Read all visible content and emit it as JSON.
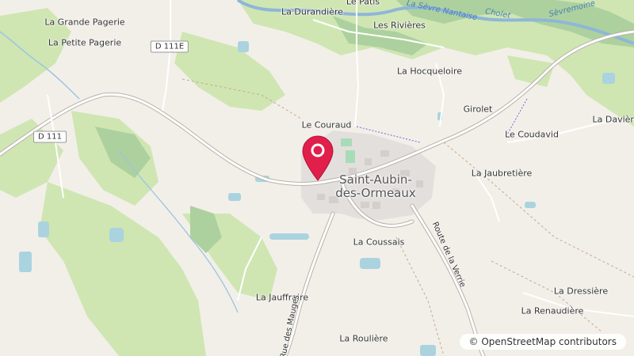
{
  "map": {
    "town_name_line1": "Saint-Aubin-",
    "town_name_line2": "des-Ormeaux",
    "places": [
      "La Grande Pagerie",
      "La Petite Pagerie",
      "La Durandière",
      "Le Patis",
      "Les Rivières",
      "La Hocqueloire",
      "Girolet",
      "La Davière",
      "Le Couraud",
      "Le Coudavid",
      "La Jaubretière",
      "La Coussais",
      "La Jauffraire",
      "La Dressière",
      "La Renaudière",
      "La Roulière"
    ],
    "road_refs": [
      "D 111E",
      "D 111"
    ],
    "road_names": [
      "Route de la Verrie",
      "Rue des Mauges"
    ],
    "river_names": [
      "La Sèvre Nantaise",
      "Sèvremoine",
      "Cholet"
    ],
    "marker_color": "#e0204a",
    "attribution": "© OpenStreetMap contributors"
  }
}
